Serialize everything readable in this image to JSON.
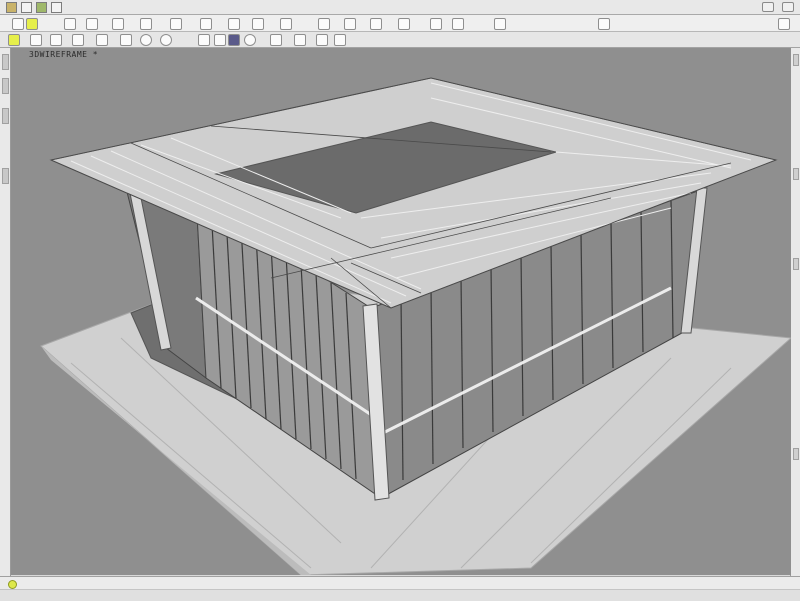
{
  "window": {
    "title": ""
  },
  "toolbar": {
    "buttons": [
      "new",
      "open",
      "save",
      "print",
      "undo",
      "redo",
      "cut",
      "copy",
      "paste",
      "zoom",
      "pan",
      "orbit",
      "render",
      "layers",
      "props",
      "grid",
      "snap",
      "measure"
    ]
  },
  "viewport": {
    "label": "3DWIREFRAME *",
    "background_color": "#8f8f8f",
    "model": "steel-frame-building"
  },
  "statusbar": {
    "text": "",
    "coordinates": ""
  },
  "colors": {
    "accent": "#dde84a",
    "viewport_bg": "#8f8f8f",
    "slab": "#d0d0d0",
    "frame": "#cfcfcf"
  }
}
